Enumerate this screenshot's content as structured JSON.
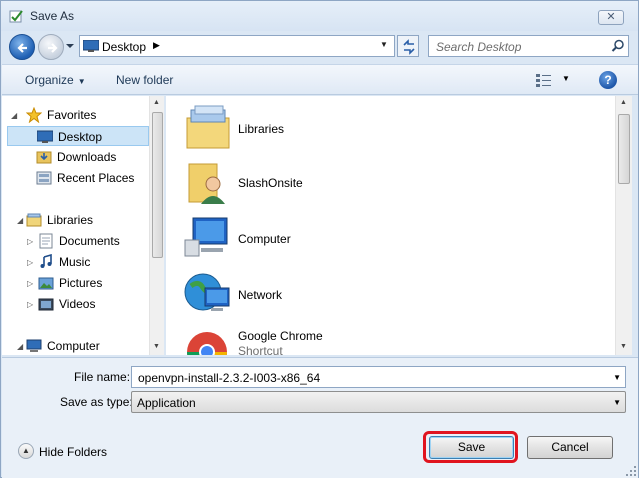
{
  "window": {
    "title": "Save As",
    "close_glyph": "✕"
  },
  "address_bar": {
    "location": "Desktop",
    "location_icon": "desktop-icon"
  },
  "search": {
    "placeholder": "Search Desktop"
  },
  "toolbar": {
    "organize_label": "Organize",
    "new_folder_label": "New folder",
    "help_glyph": "?"
  },
  "nav_pane": {
    "favorites_label": "Favorites",
    "favorites": [
      {
        "label": "Desktop",
        "icon": "desktop-icon",
        "selected": true
      },
      {
        "label": "Downloads",
        "icon": "downloads-folder-icon"
      },
      {
        "label": "Recent Places",
        "icon": "recent-places-icon"
      }
    ],
    "libraries_label": "Libraries",
    "libraries": [
      {
        "label": "Documents",
        "icon": "documents-icon"
      },
      {
        "label": "Music",
        "icon": "music-icon"
      },
      {
        "label": "Pictures",
        "icon": "pictures-icon"
      },
      {
        "label": "Videos",
        "icon": "videos-icon"
      }
    ],
    "computer_label": "Computer"
  },
  "content": {
    "items": [
      {
        "name": "Libraries",
        "icon": "libraries-icon",
        "sub": ""
      },
      {
        "name": "SlashOnsite",
        "icon": "user-folder-icon",
        "sub": ""
      },
      {
        "name": "Computer",
        "icon": "computer-icon",
        "sub": ""
      },
      {
        "name": "Network",
        "icon": "network-icon",
        "sub": ""
      },
      {
        "name": "Google Chrome",
        "icon": "chrome-icon",
        "sub": "Shortcut"
      }
    ]
  },
  "form": {
    "file_name_label": "File name:",
    "file_name_value": "openvpn-install-2.3.2-I003-x86_64",
    "save_as_type_label": "Save as type:",
    "save_as_type_value": "Application"
  },
  "footer": {
    "hide_folders_label": "Hide Folders",
    "save_label": "Save",
    "cancel_label": "Cancel",
    "highlight_color": "#e0141f"
  }
}
